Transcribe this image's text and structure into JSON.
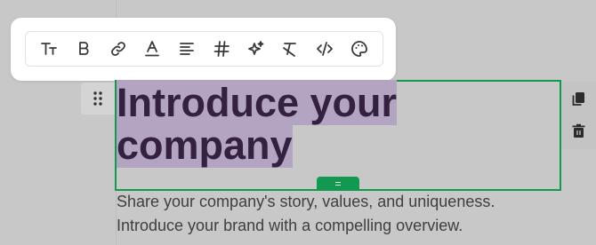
{
  "toolbar": {
    "buttons": [
      {
        "name": "text-size-icon"
      },
      {
        "name": "bold-icon"
      },
      {
        "name": "link-icon"
      },
      {
        "name": "text-color-icon"
      },
      {
        "name": "align-icon"
      },
      {
        "name": "hashtag-icon"
      },
      {
        "name": "ai-sparkle-icon"
      },
      {
        "name": "clear-format-icon"
      },
      {
        "name": "code-icon"
      },
      {
        "name": "palette-icon"
      }
    ]
  },
  "block": {
    "heading_line1": "Introduce your",
    "heading_line2": "company",
    "tab_label": "="
  },
  "paragraph": {
    "line1": "Share your company's story, values, and uniqueness.",
    "line2": "Introduce your brand with a compelling overview."
  },
  "colors": {
    "accent": "#12984f",
    "heading": "#33213f",
    "selection": "#b3a5c2",
    "background": "#c8c8c8"
  }
}
